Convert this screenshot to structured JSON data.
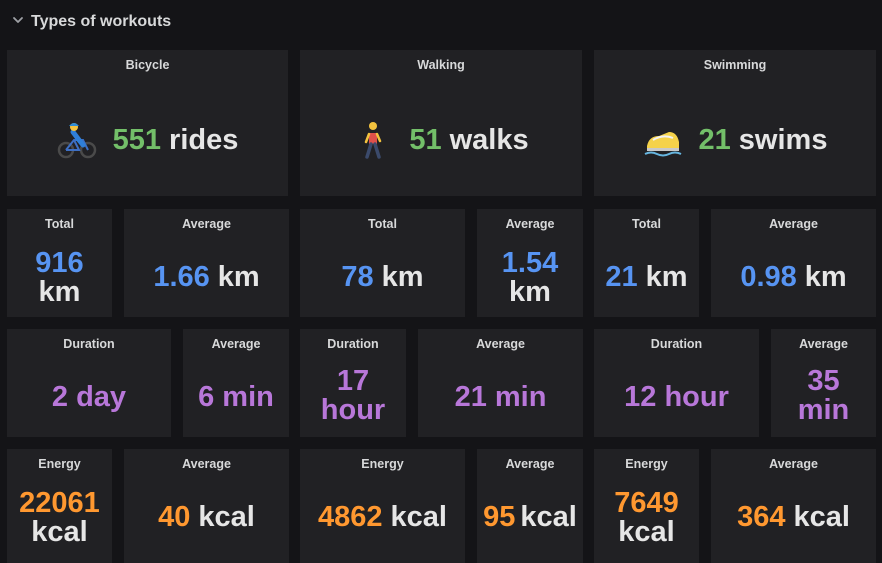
{
  "row": {
    "title": "Types of workouts",
    "icon": "chevron-down-icon"
  },
  "colors": {
    "green": "#73bf69",
    "blue": "#5794f2",
    "purple": "#b877d9",
    "orange": "#ff9830",
    "panel": "#212124",
    "background": "#141417"
  },
  "workouts": [
    {
      "title": "Bicycle",
      "icon": "bicycle-rider-icon",
      "count": "551",
      "unit": "rides"
    },
    {
      "title": "Walking",
      "icon": "walking-person-icon",
      "count": "51",
      "unit": "walks"
    },
    {
      "title": "Swimming",
      "icon": "swimming-shoe-icon",
      "count": "21",
      "unit": "swims"
    }
  ],
  "distance": [
    {
      "total_title": "Total",
      "total_value": "916",
      "total_unit": "km",
      "avg_title": "Average",
      "avg_value": "1.66",
      "avg_unit": "km"
    },
    {
      "total_title": "Total",
      "total_value": "78",
      "total_unit": "km",
      "avg_title": "Average",
      "avg_value": "1.54",
      "avg_unit": "km"
    },
    {
      "total_title": "Total",
      "total_value": "21",
      "total_unit": "km",
      "avg_title": "Average",
      "avg_value": "0.98",
      "avg_unit": "km"
    }
  ],
  "duration": [
    {
      "total_title": "Duration",
      "total_value": "2 day",
      "avg_title": "Average",
      "avg_value": "6 min"
    },
    {
      "total_title": "Duration",
      "total_value_line1": "17",
      "total_value_line2": "hour",
      "avg_title": "Average",
      "avg_value": "21 min"
    },
    {
      "total_title": "Duration",
      "total_value": "12 hour",
      "avg_title": "Average",
      "avg_value_line1": "35",
      "avg_value_line2": "min"
    }
  ],
  "energy": [
    {
      "total_title": "Energy",
      "total_value": "22061",
      "total_unit": "kcal",
      "avg_title": "Average",
      "avg_value": "40",
      "avg_unit": "kcal"
    },
    {
      "total_title": "Energy",
      "total_value": "4862",
      "total_unit": "kcal",
      "avg_title": "Average",
      "avg_value": "95",
      "avg_unit": "kcal"
    },
    {
      "total_title": "Energy",
      "total_value": "7649",
      "total_unit": "kcal",
      "avg_title": "Average",
      "avg_value": "364",
      "avg_unit": "kcal"
    }
  ]
}
